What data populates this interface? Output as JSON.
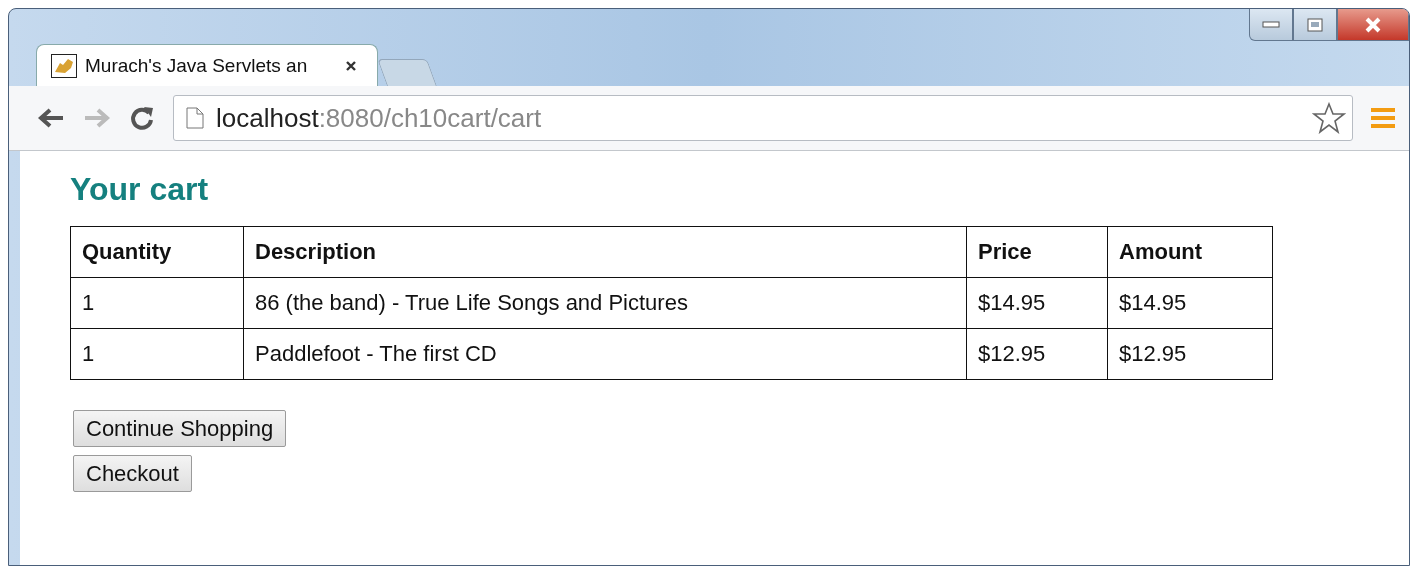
{
  "browser": {
    "tab": {
      "title": "Murach's Java Servlets an",
      "selected": true
    },
    "address": {
      "host": "localhost",
      "path": ":8080/ch10cart/cart"
    }
  },
  "page": {
    "heading": "Your cart",
    "table": {
      "columns": [
        "Quantity",
        "Description",
        "Price",
        "Amount"
      ],
      "rows": [
        [
          "1",
          "86 (the band) - True Life Songs and Pictures",
          "$14.95",
          "$14.95"
        ],
        [
          "1",
          "Paddlefoot - The first CD",
          "$12.95",
          "$12.95"
        ]
      ]
    },
    "buttons": [
      "Continue Shopping",
      "Checkout"
    ]
  }
}
